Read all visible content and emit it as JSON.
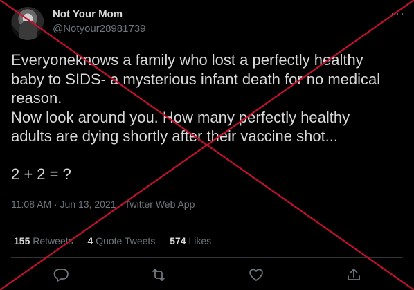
{
  "tweet": {
    "display_name": "Not Your Mom",
    "handle": "@Notyour28981739",
    "more_label": "···",
    "body_lines": [
      "Everyoneknows a family who lost a perfectly healthy",
      "baby to SIDS- a mysterious infant death for no medical",
      "reason.",
      "Now look around you. How many perfectly healthy",
      "adults are dying shortly after their vaccine shot...",
      "",
      "2 + 2 = ?"
    ],
    "timestamp": "11:08 AM · Jun 13, 2021 · Twitter Web App",
    "stats": {
      "retweets_count": "155",
      "retweets_label": "Retweets",
      "quotes_count": "4",
      "quotes_label": "Quote Tweets",
      "likes_count": "574",
      "likes_label": "Likes"
    },
    "actions": [
      "reply-icon",
      "retweet-icon",
      "like-icon",
      "share-icon"
    ]
  },
  "colors": {
    "background": "#000000",
    "primary_text": "#d9d9d9",
    "secondary_text": "#6e767d",
    "divider": "#2f3336",
    "strike_overlay": "#c8102e"
  }
}
